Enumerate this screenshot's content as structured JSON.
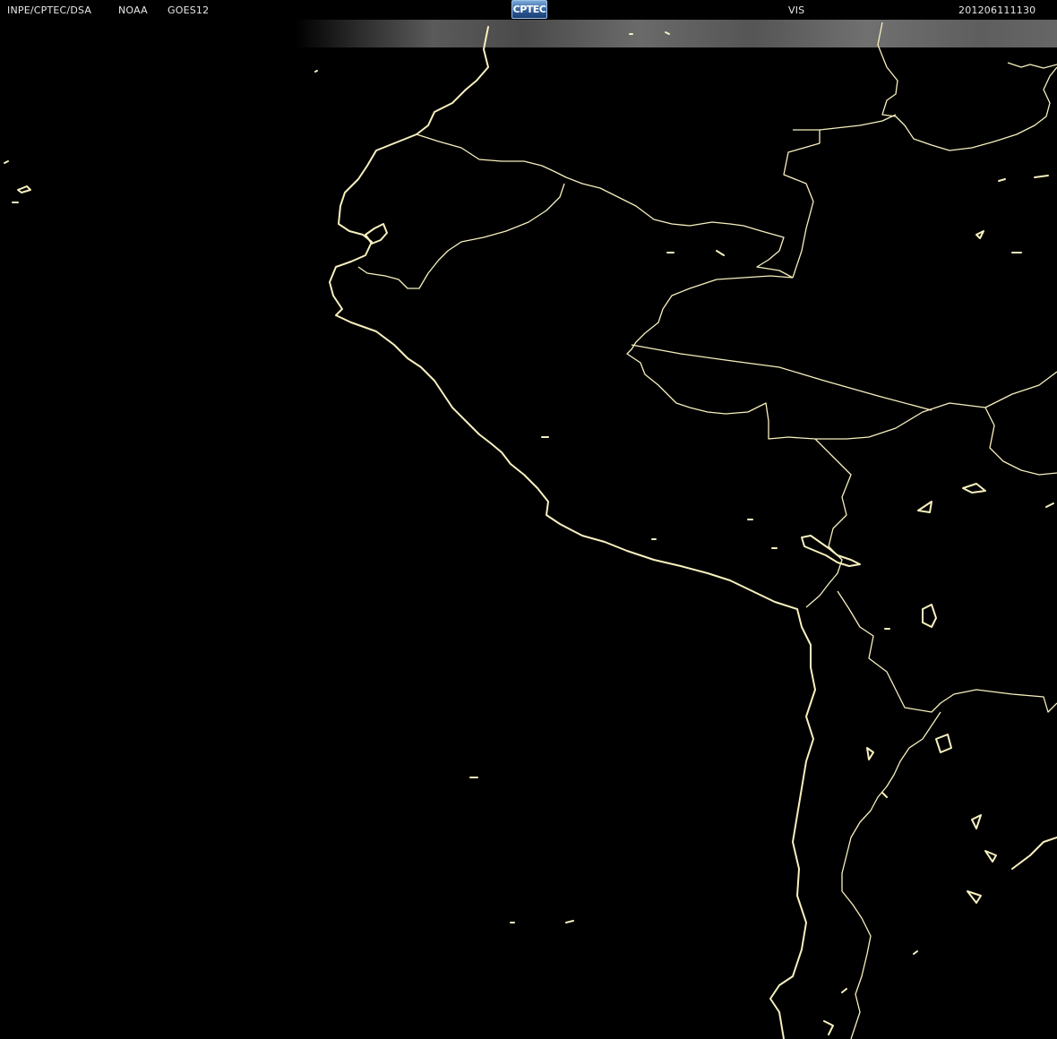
{
  "header": {
    "institution": "INPE/CPTEC/DSA",
    "agency": "NOAA",
    "satellite": "GOES12",
    "logo_text": "CPTEC",
    "channel": "VIS",
    "timestamp": "201206111130"
  },
  "colors": {
    "background": "#000000",
    "outline": "#f7f0be",
    "text": "#e8e8e8"
  }
}
